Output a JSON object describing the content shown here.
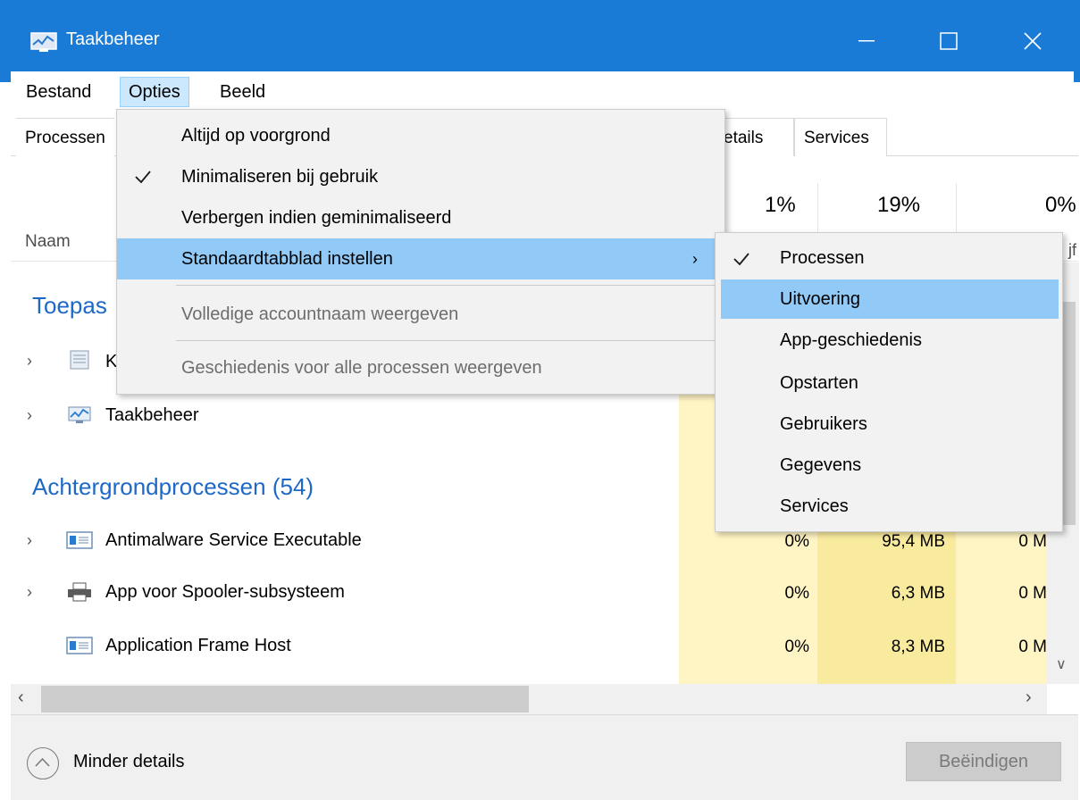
{
  "window": {
    "title": "Taakbeheer",
    "icon": "task-manager-icon"
  },
  "menubar": {
    "items": [
      "Bestand",
      "Opties",
      "Beeld"
    ]
  },
  "tabs": {
    "left_partial": "Processen",
    "details_partial": "etails",
    "services": "Services"
  },
  "columns": {
    "naam": "Naam",
    "cpu_pct": "1%",
    "mem_pct": "19%",
    "disk_pct": "0%",
    "disk_suffix": "jf"
  },
  "sections": {
    "apps_partial": "Toepas",
    "background": "Achtergrondprocessen (54)"
  },
  "rows": [
    {
      "name": "K",
      "icon": "notepad-icon",
      "expandable": true,
      "cpu": "",
      "mem": "",
      "disk": ""
    },
    {
      "name": "Taakbeheer",
      "icon": "task-manager-icon",
      "expandable": true,
      "cpu": "",
      "mem": "",
      "disk": ""
    },
    {
      "name": "Antimalware Service Executable",
      "icon": "service-window-icon",
      "expandable": true,
      "cpu": "0%",
      "mem": "95,4 MB",
      "disk": "0 M"
    },
    {
      "name": "App voor Spooler-subsysteem",
      "icon": "printer-icon",
      "expandable": true,
      "cpu": "0%",
      "mem": "6,3 MB",
      "disk": "0 M"
    },
    {
      "name": "Application Frame Host",
      "icon": "service-window-icon",
      "expandable": false,
      "cpu": "0%",
      "mem": "8,3 MB",
      "disk": "0 M"
    }
  ],
  "options_menu": {
    "items": [
      {
        "label": "Altijd op voorgrond",
        "checked": false,
        "disabled": false
      },
      {
        "label": "Minimaliseren bij gebruik",
        "checked": true,
        "disabled": false
      },
      {
        "label": "Verbergen indien geminimaliseerd",
        "checked": false,
        "disabled": false
      },
      {
        "label": "Standaardtabblad instellen",
        "checked": false,
        "disabled": false,
        "submenu": true,
        "highlighted": true
      },
      {
        "label": "Volledige accountnaam weergeven",
        "checked": false,
        "disabled": true
      },
      {
        "label": "Geschiedenis voor alle processen weergeven",
        "checked": false,
        "disabled": true
      }
    ]
  },
  "default_tab_submenu": {
    "items": [
      {
        "label": "Processen",
        "checked": true
      },
      {
        "label": "Uitvoering",
        "highlighted": true
      },
      {
        "label": "App-geschiedenis"
      },
      {
        "label": "Opstarten"
      },
      {
        "label": "Gebruikers"
      },
      {
        "label": "Gegevens"
      },
      {
        "label": "Services"
      }
    ]
  },
  "footer": {
    "less_details": "Minder details",
    "end_task": "Beëindigen"
  },
  "colors": {
    "titlebar": "#1a7bd6",
    "section_title": "#1e69c8",
    "highlight": "#91c9f7",
    "heat_light": "#fff4c4",
    "heat_mid": "#f9eb9e"
  }
}
